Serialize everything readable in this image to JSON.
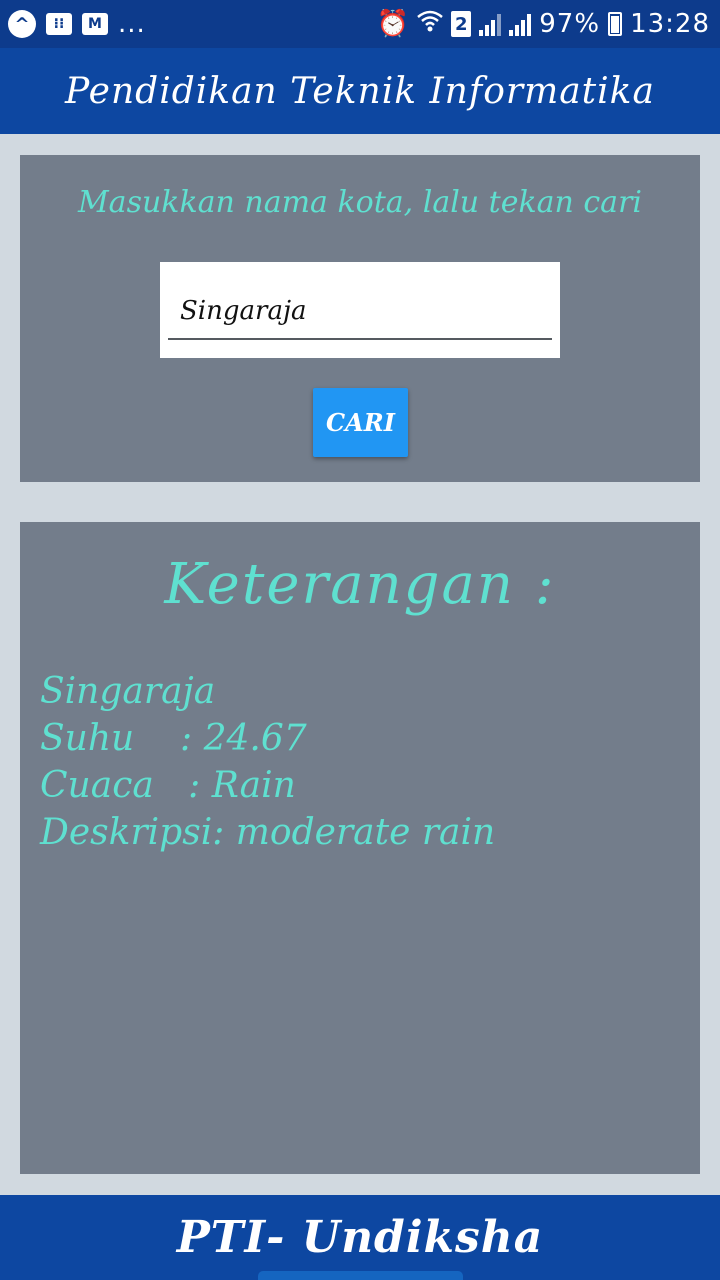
{
  "status_bar": {
    "overflow": "...",
    "sim_slot": "2",
    "battery": "97%",
    "time": "13:28",
    "icons_left": [
      "notification-a-icon",
      "bbm-icon",
      "mail-icon"
    ],
    "icons_right": [
      "alarm-icon",
      "wifi-icon",
      "sim-2-icon",
      "signal-icon",
      "signal-icon",
      "battery-icon"
    ]
  },
  "header": {
    "title": "Pendidikan Teknik Informatika"
  },
  "search": {
    "prompt": "Masukkan nama kota, lalu tekan cari",
    "input_value": "Singaraja",
    "button_label": "CARI"
  },
  "result": {
    "title": "Keterangan :",
    "lines": [
      "Singaraja",
      "Suhu    : 24.67",
      "Cuaca   : Rain",
      "Deskripsi: moderate rain"
    ]
  },
  "footer": {
    "text": "PTI- Undiksha"
  },
  "colors": {
    "status_bar": "#0d3b8c",
    "app_bar": "#0d47a1",
    "card": "#737d8b",
    "accent_text": "#5fe0d0",
    "button": "#2196f3",
    "background": "#d1d9e0"
  }
}
